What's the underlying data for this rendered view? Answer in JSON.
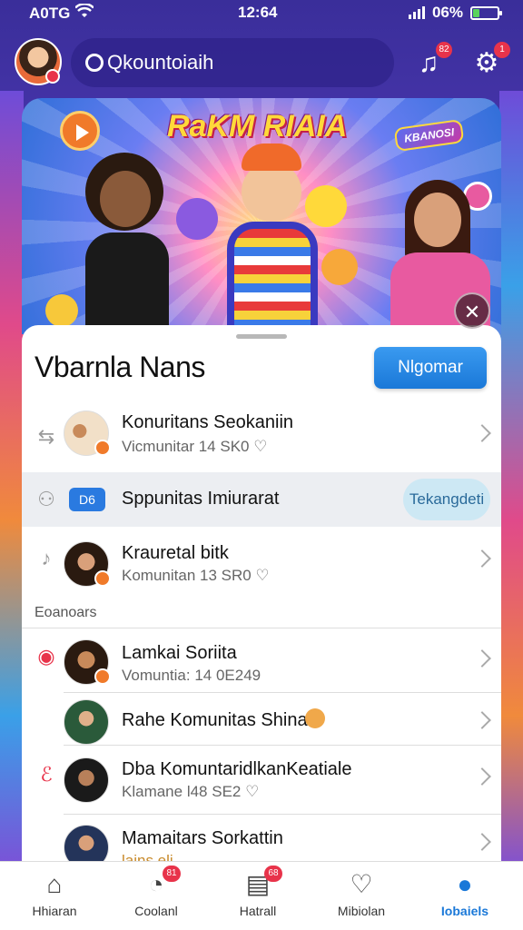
{
  "status_bar": {
    "carrier": "A0TG",
    "time": "12:64",
    "battery": "06%",
    "battery_level": 0.25
  },
  "header": {
    "search_text": "Qkountoiaih",
    "music_badge": "82",
    "notif_badge": "1"
  },
  "banner": {
    "title": "RaKM RIAIA",
    "logo_text": "KBANOSI"
  },
  "sheet": {
    "title": "Vbarnla Nans",
    "primary_button": "Nlgomar",
    "section_label": "Eoanoars",
    "highlight_row": {
      "tag": "D6",
      "name": "Sppunitas Imiurarat",
      "button": "Tekangdeti"
    },
    "rows_top": [
      {
        "name": "Konuritans Seokaniin",
        "sub": "Vicmunitar 14 SK0 ♡"
      },
      {
        "name": "Krauretal bitk",
        "sub": "Komunitan 13 SR0 ♡"
      }
    ],
    "rows_bottom": [
      {
        "name": "Lamkai Soriita",
        "sub": "Vomuntia: 14 0E249"
      },
      {
        "name": "Rahe Komunitas Shinal",
        "sub": ""
      },
      {
        "name": "Dba KomuntaridlkanKeatiale",
        "sub": "Klamane l48 SE2 ♡"
      },
      {
        "name": "Mamaitars Sorkattin",
        "sub": "lains eli"
      }
    ]
  },
  "bottom_nav": [
    {
      "label": "Hhiaran",
      "badge": ""
    },
    {
      "label": "Coolanl",
      "badge": "81"
    },
    {
      "label": "Hatrall",
      "badge": "68"
    },
    {
      "label": "Mibiolan",
      "badge": ""
    },
    {
      "label": "Iobaiels",
      "badge": ""
    }
  ],
  "colors": {
    "accent": "#1a78d8",
    "badge": "#e8334a",
    "header_bg": "#3a2e9a"
  },
  "icons": {
    "header": [
      "music-icon",
      "gear-icon"
    ],
    "nav": [
      "home-icon",
      "chat-icon",
      "news-icon",
      "heart-icon",
      "profile-icon"
    ]
  }
}
